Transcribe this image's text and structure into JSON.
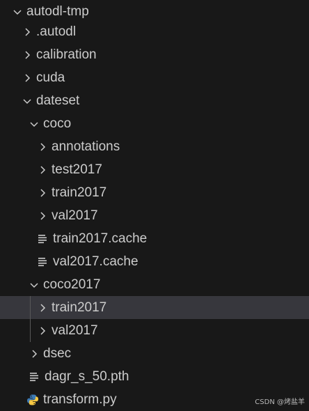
{
  "explorer": {
    "items": [
      {
        "label": "autodl-tmp",
        "kind": "folder",
        "state": "expanded",
        "depth": 0
      },
      {
        "label": ".autodl",
        "kind": "folder",
        "state": "collapsed",
        "depth": 1
      },
      {
        "label": "calibration",
        "kind": "folder",
        "state": "collapsed",
        "depth": 1
      },
      {
        "label": "cuda",
        "kind": "folder",
        "state": "collapsed",
        "depth": 1
      },
      {
        "label": "dateset",
        "kind": "folder",
        "state": "expanded",
        "depth": 1
      },
      {
        "label": "coco",
        "kind": "folder",
        "state": "expanded",
        "depth": 2
      },
      {
        "label": "annotations",
        "kind": "folder",
        "state": "collapsed",
        "depth": 3
      },
      {
        "label": "test2017",
        "kind": "folder",
        "state": "collapsed",
        "depth": 3
      },
      {
        "label": "train2017",
        "kind": "folder",
        "state": "collapsed",
        "depth": 3
      },
      {
        "label": "val2017",
        "kind": "folder",
        "state": "collapsed",
        "depth": 3
      },
      {
        "label": "train2017.cache",
        "kind": "file",
        "icon": "lines-file-icon",
        "depth": 3
      },
      {
        "label": "val2017.cache",
        "kind": "file",
        "icon": "lines-file-icon",
        "depth": 3
      },
      {
        "label": "coco2017",
        "kind": "folder",
        "state": "expanded",
        "depth": 2
      },
      {
        "label": "train2017",
        "kind": "folder",
        "state": "collapsed",
        "depth": 3,
        "selected": true
      },
      {
        "label": "val2017",
        "kind": "folder",
        "state": "collapsed",
        "depth": 3
      },
      {
        "label": "dsec",
        "kind": "folder",
        "state": "collapsed",
        "depth": 2
      },
      {
        "label": "dagr_s_50.pth",
        "kind": "file",
        "icon": "lines-file-icon",
        "depth": 2
      },
      {
        "label": "transform.py",
        "kind": "file",
        "icon": "python-icon",
        "depth": 2
      }
    ]
  },
  "colors": {
    "background": "#181818",
    "selected_row": "#37373d",
    "text": "#cccccc",
    "python_blue": "#3c7ab5",
    "python_yellow": "#f7c843"
  },
  "watermark": "CSDN @烤盐羊"
}
